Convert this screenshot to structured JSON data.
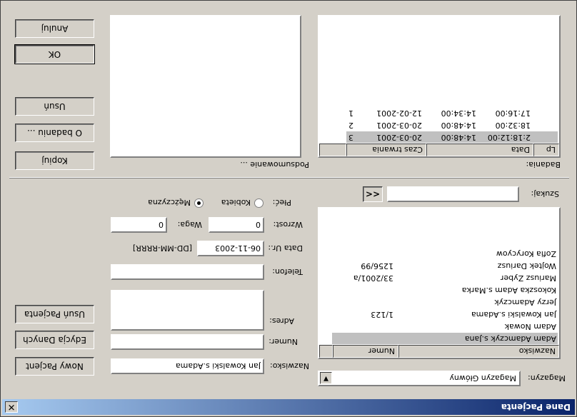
{
  "window": {
    "title": "Dane Pacjenta",
    "close_glyph": "✕"
  },
  "buttons": {
    "new_patient": "Nowy Pacjent",
    "edit_data": "Edycja Danych",
    "delete_patient": "Usuń Pacjenta",
    "copy": "Kopiuj",
    "about_exam": "O badaniu ...",
    "delete": "Usuń",
    "ok": "OK",
    "cancel": "Anuluj",
    "search_back": "<<"
  },
  "warehouse": {
    "label": "Magazyn:",
    "value": "Magazyn Główny"
  },
  "search": {
    "label": "Szukaj:",
    "value": ""
  },
  "patients": {
    "columns": [
      "Nazwisko",
      "Numer"
    ],
    "rows": [
      {
        "name": "Adam Adamczyk s.Jana",
        "number": "",
        "selected": true
      },
      {
        "name": "Adam Nowak",
        "number": ""
      },
      {
        "name": "Jan Kowalski s.Adama",
        "number": "1/123"
      },
      {
        "name": "Jerzy Adamczyk",
        "number": ""
      },
      {
        "name": "Kokoszka Adam s.Marka",
        "number": ""
      },
      {
        "name": "Mariusz Zyber",
        "number": "33/2001/a"
      },
      {
        "name": "Wojtek Dariusz",
        "number": "1256/99"
      },
      {
        "name": "Zofia Korycyow",
        "number": ""
      }
    ]
  },
  "form": {
    "surname_label": "Nazwisko:",
    "surname_value": "Jan Kowalski s.Adama",
    "number_label": "Numer:",
    "number_value": "",
    "address_label": "Adres:",
    "address_value": "",
    "phone_label": "Telefon:",
    "phone_value": "",
    "birth_label": "Data Ur.:",
    "birth_value": "06-11-2003",
    "birth_hint": "[DD-MM-RRRR]",
    "height_label": "Wzrost:",
    "height_value": "0",
    "weight_label": "Waga:",
    "weight_value": "0",
    "sex_label": "Płeć:",
    "sex_female": "Kobieta",
    "sex_male": "Mężczyzna",
    "sex_selected": "male"
  },
  "exams": {
    "label": "Badania:",
    "columns": [
      "Lp",
      "Data",
      "Czas trwania"
    ],
    "rows": [
      {
        "lp": "3",
        "date": "20-03-2001",
        "time": "14:48:00",
        "duration": "2:18:12:00",
        "selected": true
      },
      {
        "lp": "2",
        "date": "20-03-2001",
        "time": "14:48:00",
        "duration": "18:32:00"
      },
      {
        "lp": "1",
        "date": "12-02-2001",
        "time": "14:34:00",
        "duration": "17:16:00"
      }
    ]
  },
  "summary": {
    "label": "Podsumowanie ...",
    "value": ""
  },
  "colors": {
    "face": "#d4d0c8",
    "title_start": "#0a246a",
    "title_end": "#a6caf0",
    "selection": "#c0c0c0"
  }
}
